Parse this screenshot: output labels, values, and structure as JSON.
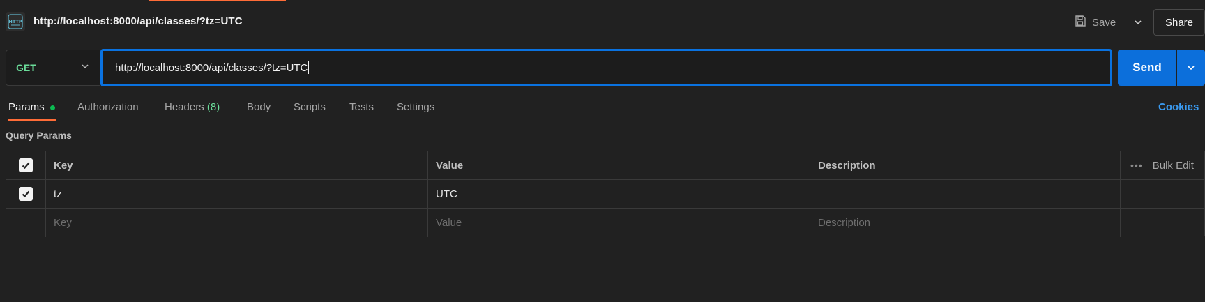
{
  "header": {
    "icon": "http-icon",
    "icon_text": "HTTP",
    "title": "http://localhost:8000/api/classes/?tz=UTC",
    "save_label": "Save",
    "share_label": "Share"
  },
  "request": {
    "method": "GET",
    "url": "http://localhost:8000/api/classes/?tz=UTC",
    "send_label": "Send"
  },
  "tabs": [
    {
      "label": "Params",
      "active": true,
      "has_dot": true
    },
    {
      "label": "Authorization"
    },
    {
      "label": "Headers",
      "count": "(8)"
    },
    {
      "label": "Body"
    },
    {
      "label": "Scripts"
    },
    {
      "label": "Tests"
    },
    {
      "label": "Settings"
    }
  ],
  "cookies_label": "Cookies",
  "query_params": {
    "label": "Query Params",
    "headers": {
      "key": "Key",
      "value": "Value",
      "description": "Description",
      "bulk_edit": "Bulk Edit"
    },
    "rows": [
      {
        "key": "tz",
        "value": "UTC",
        "description": "",
        "checked": true
      }
    ],
    "placeholders": {
      "key": "Key",
      "value": "Value",
      "description": "Description"
    }
  },
  "colors": {
    "accent": "#ff6c37",
    "method_get": "#6bdd9a",
    "send": "#0c6fdb",
    "link": "#3a9af0",
    "active_dot": "#0cbb52"
  }
}
